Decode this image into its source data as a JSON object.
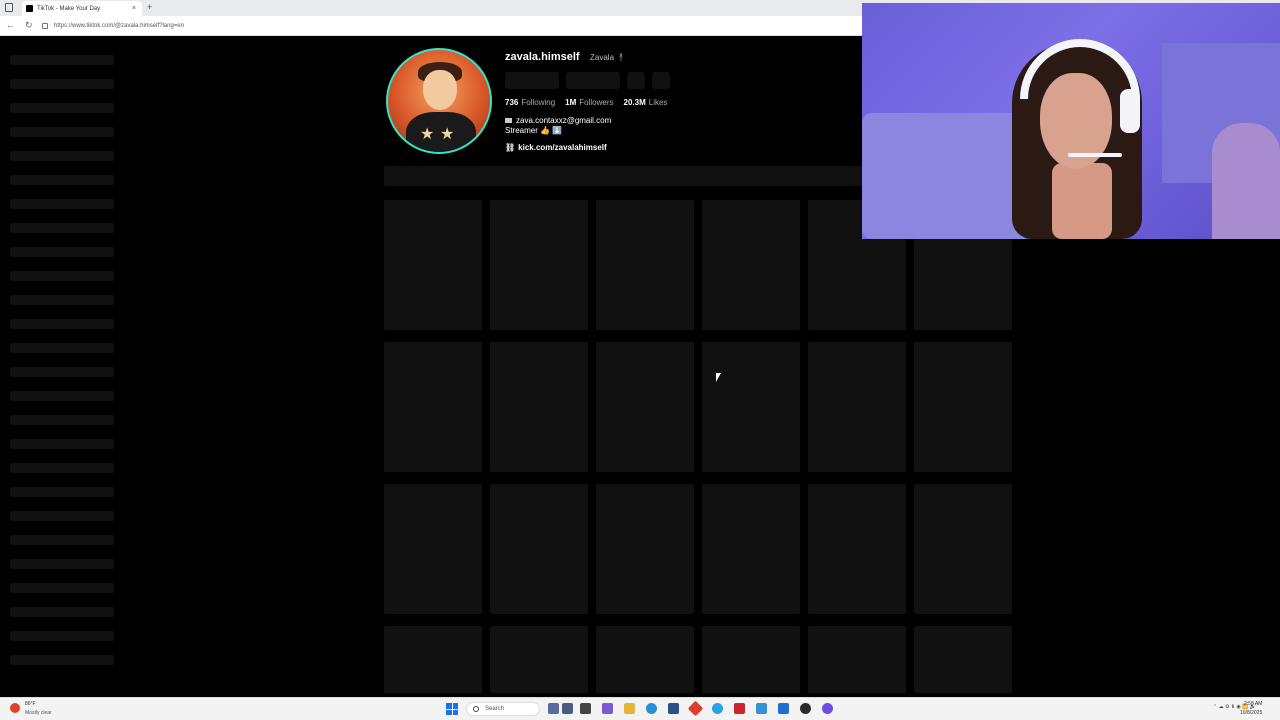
{
  "browser": {
    "tab_title": "TikTok - Make Your Day",
    "tab_close": "×",
    "new_tab": "+",
    "url": "https://www.tiktok.com/@zavala.himself?lang=en",
    "back": "←",
    "forward": "→",
    "reload": "↻"
  },
  "profile": {
    "username": "zavala.himself",
    "display_name": "Zavala 🕴",
    "stats": {
      "following_count": "736",
      "following_label": "Following",
      "followers_count": "1M",
      "followers_label": "Followers",
      "likes_count": "20.3M",
      "likes_label": "Likes"
    },
    "bio_email": "zava.contaxxz@gmail.com",
    "bio_line2": "Streamer 👍 ⬇️",
    "link": "kick.com/zavalahimself"
  },
  "taskbar": {
    "weather_temp": "86°F",
    "weather_desc": "Mostly clear",
    "search_placeholder": "Search",
    "clock_time": "2:58 AM",
    "clock_date": "10/8/2025"
  },
  "colors": {
    "avatar_ring": "#2ee6c8",
    "page_bg": "#000000",
    "skeleton": "#111111",
    "start_blue": "#1a73e8"
  }
}
